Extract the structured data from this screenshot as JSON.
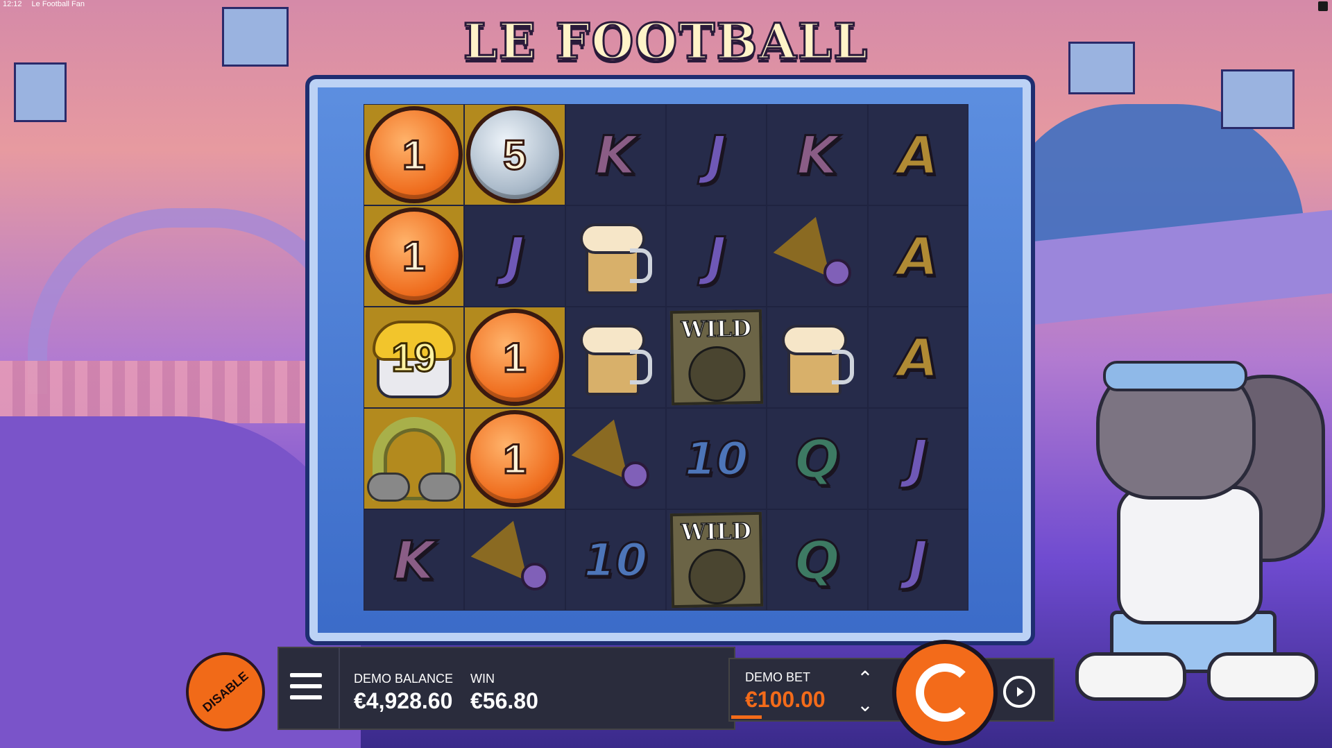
{
  "system": {
    "time": "12:12",
    "window_title": "Le Football Fan"
  },
  "game": {
    "title": "LE FOOTBALL FAN"
  },
  "grid": {
    "rows": [
      [
        {
          "type": "coin",
          "variant": "orange",
          "value": "1",
          "win": true
        },
        {
          "type": "coin",
          "variant": "silver",
          "value": "5",
          "win": true
        },
        {
          "type": "letter",
          "value": "K"
        },
        {
          "type": "letter",
          "value": "J"
        },
        {
          "type": "letter",
          "value": "K"
        },
        {
          "type": "letter",
          "value": "A"
        }
      ],
      [
        {
          "type": "coin",
          "variant": "orange",
          "value": "1",
          "win": true
        },
        {
          "type": "letter",
          "value": "J"
        },
        {
          "type": "beer"
        },
        {
          "type": "letter",
          "value": "J"
        },
        {
          "type": "horn"
        },
        {
          "type": "letter",
          "value": "A"
        }
      ],
      [
        {
          "type": "pot",
          "value": "19",
          "win": true
        },
        {
          "type": "coin",
          "variant": "orange",
          "value": "1",
          "win": true
        },
        {
          "type": "beer"
        },
        {
          "type": "wild",
          "value": "WILD"
        },
        {
          "type": "beer"
        },
        {
          "type": "letter",
          "value": "A"
        }
      ],
      [
        {
          "type": "rainbow",
          "win": true
        },
        {
          "type": "coin",
          "variant": "orange",
          "value": "1",
          "win": true
        },
        {
          "type": "horn"
        },
        {
          "type": "letter",
          "value": "10"
        },
        {
          "type": "letter",
          "value": "Q"
        },
        {
          "type": "letter",
          "value": "J"
        }
      ],
      [
        {
          "type": "letter",
          "value": "K"
        },
        {
          "type": "horn"
        },
        {
          "type": "letter",
          "value": "10"
        },
        {
          "type": "wild",
          "value": "WILD"
        },
        {
          "type": "letter",
          "value": "Q"
        },
        {
          "type": "letter",
          "value": "J"
        }
      ]
    ]
  },
  "hud": {
    "disable_label": "DISABLE",
    "balance_label": "DEMO BALANCE",
    "balance_value": "€4,928.60",
    "win_label": "WIN",
    "win_value": "€56.80",
    "bet_label": "DEMO BET",
    "bet_value": "€100.00"
  },
  "icons": {
    "menu": "hamburger-icon",
    "bet_up": "chevron-up-icon",
    "bet_down": "chevron-down-icon",
    "spin": "spin-icon",
    "autoplay": "autoplay-icon"
  },
  "colors": {
    "accent": "#f36b1a",
    "win_highlight": "#b38a1e",
    "reel_bg": "#262b4a"
  }
}
